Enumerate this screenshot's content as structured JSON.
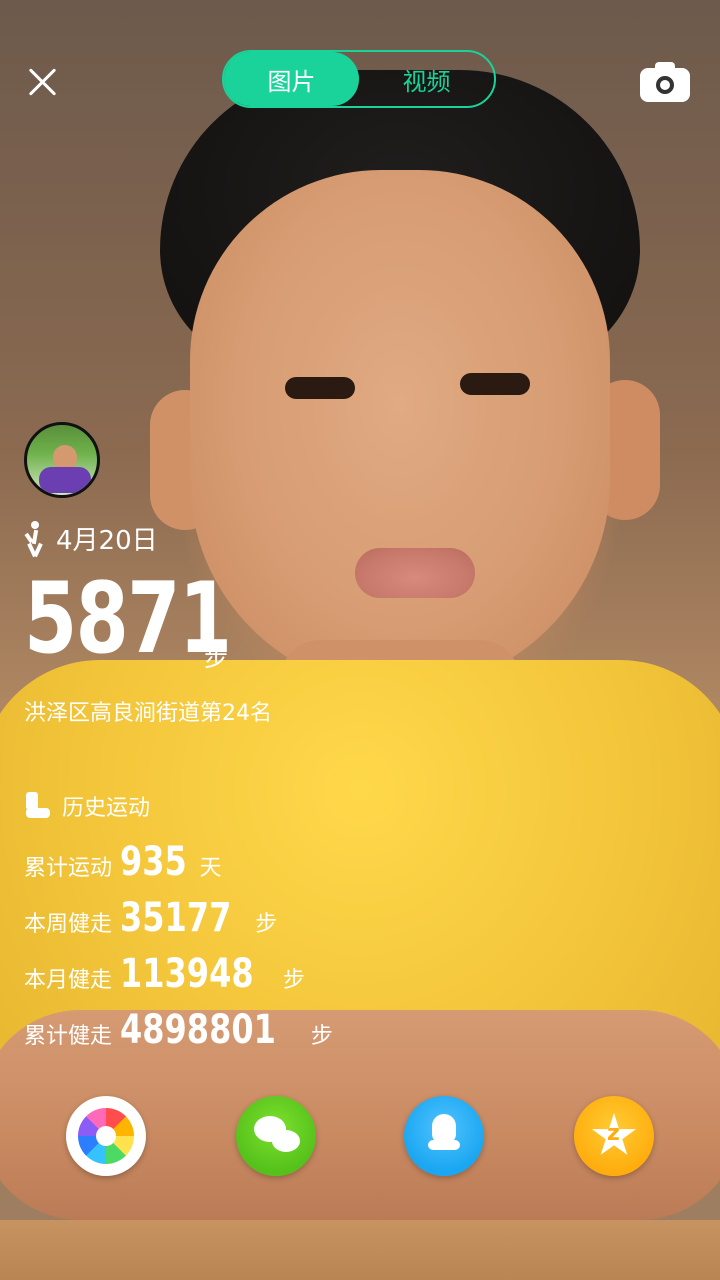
{
  "toggle": {
    "left": "图片",
    "right": "视频"
  },
  "date": "4月20日",
  "steps": {
    "value": "5871",
    "unit": "步"
  },
  "rank": "洪泽区高良涧街道第24名",
  "history": {
    "title": "历史运动",
    "stats": [
      {
        "label": "累计运动",
        "value": "935",
        "unit": "天"
      },
      {
        "label": "本周健走",
        "value": "35177",
        "unit": "步"
      },
      {
        "label": "本月健走",
        "value": "113948",
        "unit": "步"
      },
      {
        "label": "累计健走",
        "value": "4898801",
        "unit": "步"
      }
    ]
  },
  "icons": {
    "close": "close-icon",
    "camera": "camera-icon",
    "walk": "walk-icon",
    "boot": "boot-icon",
    "albums": "albums-aperture-icon",
    "wechat": "wechat-icon",
    "qq": "qq-penguin-icon",
    "qzone": "qzone-star-icon"
  },
  "colors": {
    "accent": "#19d39a",
    "text": "#ffffff",
    "wechat": "#55c11b",
    "qq": "#1aa6f1",
    "qzone": "#ffad0e"
  }
}
